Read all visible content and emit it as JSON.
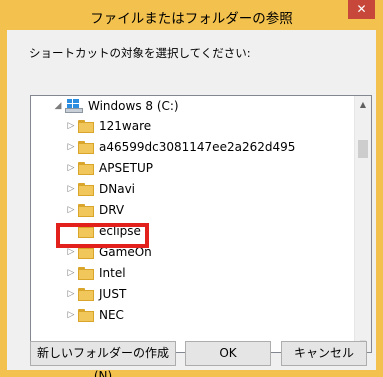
{
  "dialog": {
    "title": "ファイルまたはフォルダーの参照",
    "close_label": "✕",
    "prompt": "ショートカットの対象を選択してください:"
  },
  "tree": {
    "root": {
      "label": "Windows 8 (C:)",
      "expanded": true,
      "icon": "drive-icon"
    },
    "items": [
      {
        "label": "121ware"
      },
      {
        "label": "a46599dc3081147ee2a262d495"
      },
      {
        "label": "APSETUP"
      },
      {
        "label": "DNavi"
      },
      {
        "label": "DRV"
      },
      {
        "label": "eclipse",
        "highlighted": true
      },
      {
        "label": "GameOn"
      },
      {
        "label": "Intel"
      },
      {
        "label": "JUST"
      },
      {
        "label": "NEC"
      }
    ]
  },
  "buttons": {
    "new_folder": "新しいフォルダーの作成(N)",
    "ok": "OK",
    "cancel": "キャンセル"
  },
  "colors": {
    "title_bar": "#f2c14e",
    "close_button": "#c7473a",
    "highlight_border": "#e2201c",
    "folder": "#f1c75b"
  }
}
